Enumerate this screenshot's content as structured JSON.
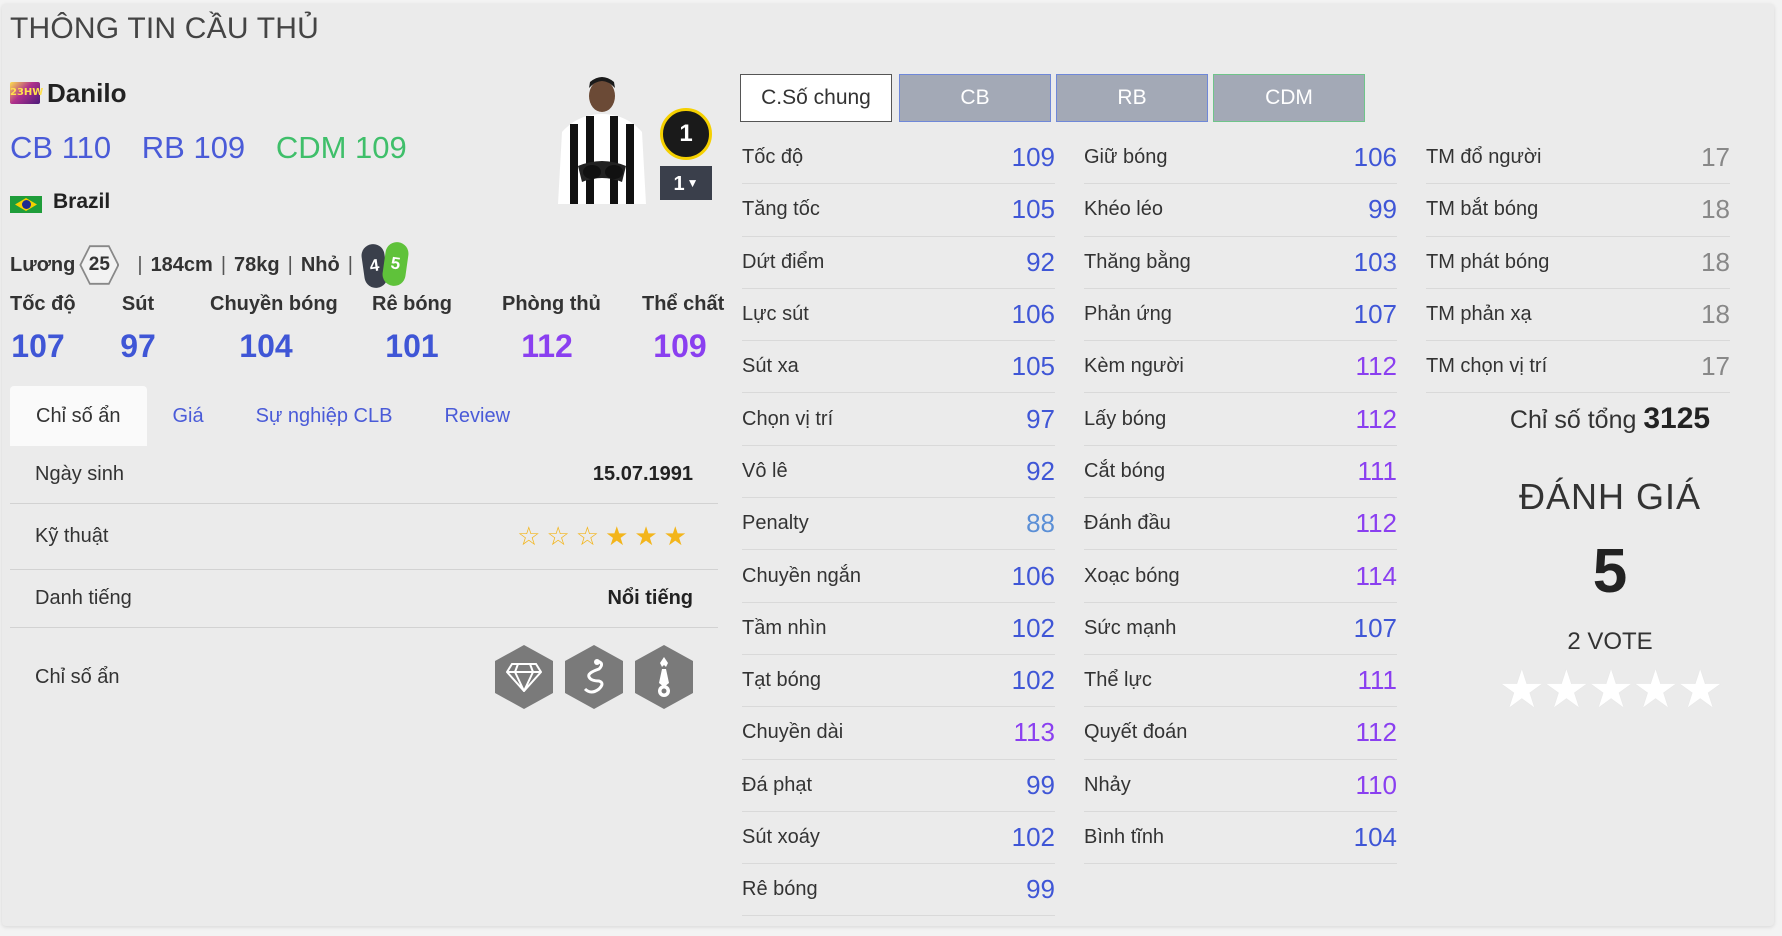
{
  "page_title": "THÔNG TIN CẦU THỦ",
  "player": {
    "season_badge": "23HW",
    "name": "Danilo",
    "positions": [
      {
        "pos": "CB",
        "ovr": "110"
      },
      {
        "pos": "RB",
        "ovr": "109"
      },
      {
        "pos": "CDM",
        "ovr": "109"
      }
    ],
    "nation": "Brazil",
    "salary_label": "Lương",
    "salary": "25",
    "height": "184cm",
    "weight": "78kg",
    "body_type": "Nhỏ",
    "weak_foot_left": "4",
    "weak_foot_right": "5",
    "upgrade_level": "1",
    "upgrade_select": "1"
  },
  "main_stats": [
    {
      "label": "Tốc độ",
      "value": "107"
    },
    {
      "label": "Sút",
      "value": "97"
    },
    {
      "label": "Chuyền bóng",
      "value": "104"
    },
    {
      "label": "Rê bóng",
      "value": "101"
    },
    {
      "label": "Phòng thủ",
      "value": "112"
    },
    {
      "label": "Thể chất",
      "value": "109"
    }
  ],
  "tabs": [
    "Chỉ số ẩn",
    "Giá",
    "Sự nghiệp CLB",
    "Review"
  ],
  "info": {
    "birth_label": "Ngày sinh",
    "birth_value": "15.07.1991",
    "skill_label": "Kỹ thuật",
    "skill_stars": 3,
    "skill_stars_max": 6,
    "fame_label": "Danh tiếng",
    "fame_value": "Nổi tiếng",
    "hidden_label": "Chỉ số ẩn",
    "hidden_traits": [
      "diamond-trait-icon",
      "snake-trait-icon",
      "tie-ball-trait-icon"
    ]
  },
  "position_buttons": [
    "C.Số chung",
    "CB",
    "RB",
    "CDM"
  ],
  "stats_col1": [
    {
      "name": "Tốc độ",
      "value": "109",
      "color": "blue"
    },
    {
      "name": "Tăng tốc",
      "value": "105",
      "color": "blue"
    },
    {
      "name": "Dứt điểm",
      "value": "92",
      "color": "blue"
    },
    {
      "name": "Lực sút",
      "value": "106",
      "color": "blue"
    },
    {
      "name": "Sút xa",
      "value": "105",
      "color": "blue"
    },
    {
      "name": "Chọn vị trí",
      "value": "97",
      "color": "blue"
    },
    {
      "name": "Vô lê",
      "value": "92",
      "color": "blue"
    },
    {
      "name": "Penalty",
      "value": "88",
      "color": "light"
    },
    {
      "name": "Chuyền ngắn",
      "value": "106",
      "color": "blue"
    },
    {
      "name": "Tầm nhìn",
      "value": "102",
      "color": "blue"
    },
    {
      "name": "Tạt bóng",
      "value": "102",
      "color": "blue"
    },
    {
      "name": "Chuyền dài",
      "value": "113",
      "color": "purple"
    },
    {
      "name": "Đá phạt",
      "value": "99",
      "color": "blue"
    },
    {
      "name": "Sút xoáy",
      "value": "102",
      "color": "blue"
    },
    {
      "name": "Rê bóng",
      "value": "99",
      "color": "blue"
    }
  ],
  "stats_col2": [
    {
      "name": "Giữ bóng",
      "value": "106",
      "color": "blue"
    },
    {
      "name": "Khéo léo",
      "value": "99",
      "color": "blue"
    },
    {
      "name": "Thăng bằng",
      "value": "103",
      "color": "blue"
    },
    {
      "name": "Phản ứng",
      "value": "107",
      "color": "blue"
    },
    {
      "name": "Kèm người",
      "value": "112",
      "color": "purple"
    },
    {
      "name": "Lấy bóng",
      "value": "112",
      "color": "purple"
    },
    {
      "name": "Cắt bóng",
      "value": "111",
      "color": "purple"
    },
    {
      "name": "Đánh đầu",
      "value": "112",
      "color": "purple"
    },
    {
      "name": "Xoạc bóng",
      "value": "114",
      "color": "purple"
    },
    {
      "name": "Sức mạnh",
      "value": "107",
      "color": "blue"
    },
    {
      "name": "Thể lực",
      "value": "111",
      "color": "purple"
    },
    {
      "name": "Quyết đoán",
      "value": "112",
      "color": "purple"
    },
    {
      "name": "Nhảy",
      "value": "110",
      "color": "purple"
    },
    {
      "name": "Bình tĩnh",
      "value": "104",
      "color": "blue"
    }
  ],
  "stats_col3": [
    {
      "name": "TM đổ người",
      "value": "17",
      "color": "gray"
    },
    {
      "name": "TM bắt bóng",
      "value": "18",
      "color": "gray"
    },
    {
      "name": "TM phát bóng",
      "value": "18",
      "color": "gray"
    },
    {
      "name": "TM phản xạ",
      "value": "18",
      "color": "gray"
    },
    {
      "name": "TM chọn vị trí",
      "value": "17",
      "color": "gray"
    }
  ],
  "summary": {
    "total_label": "Chỉ số tổng",
    "total_value": "3125",
    "rating_title": "ĐÁNH GIÁ",
    "rating_value": "5",
    "votes": "2 VOTE",
    "rating_stars": 5
  },
  "colors": {
    "blue": "#3f56d6",
    "purple": "#8a3ff0",
    "light": "#5b8fd6",
    "gray": "#888888",
    "green_pos": "#3fbf6a"
  }
}
